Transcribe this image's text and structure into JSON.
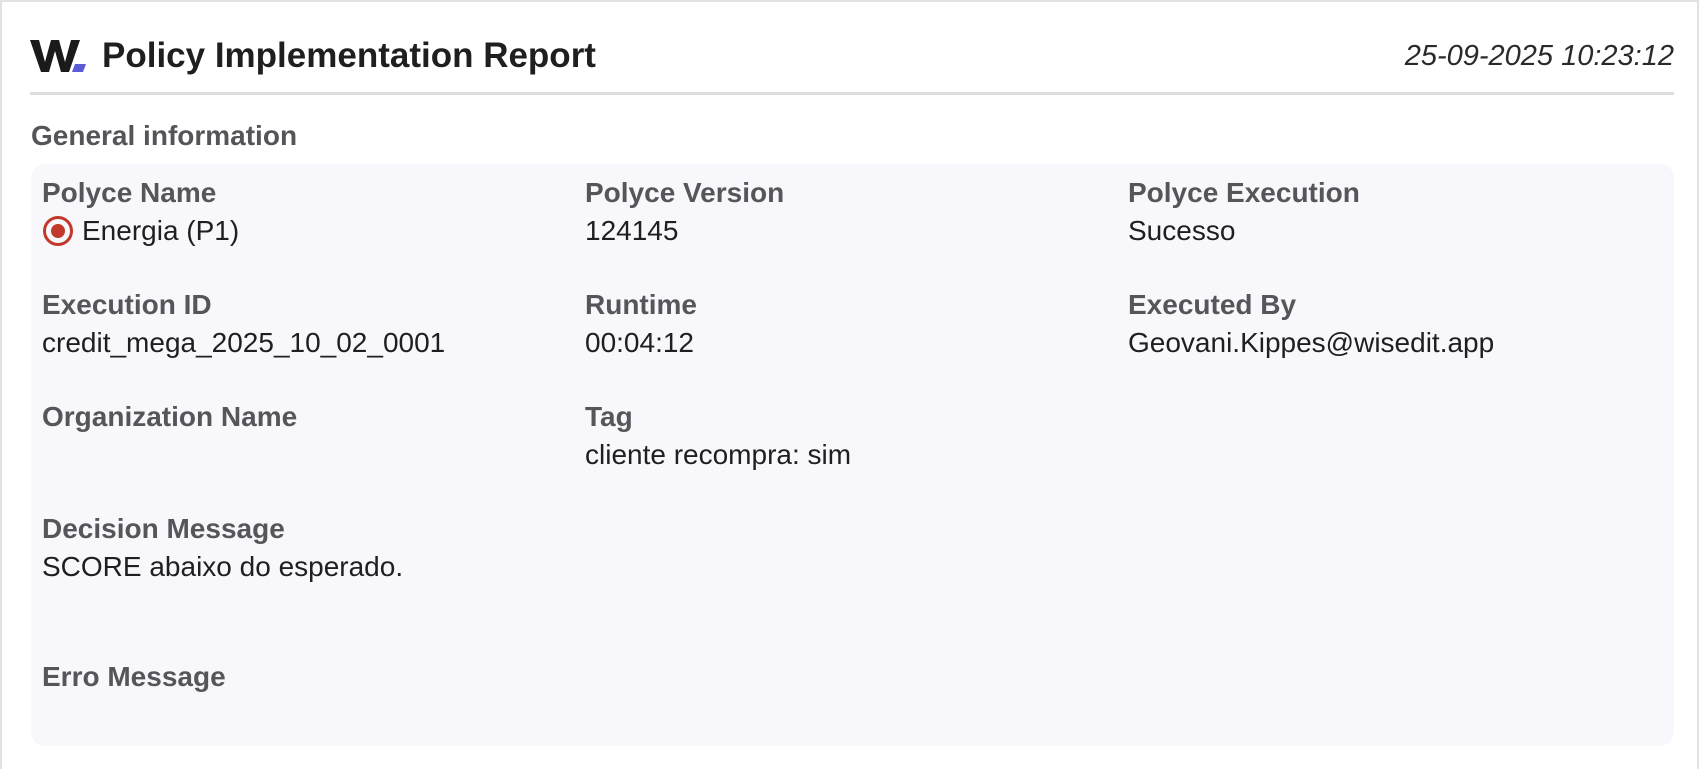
{
  "header": {
    "logo_icon": "w-brand-logo-icon",
    "title": "Policy Implementation Report",
    "timestamp": "25-09-2025 10:23:12"
  },
  "section": {
    "title": "General information"
  },
  "fields": {
    "policy_name": {
      "label": "Polyce Name",
      "value": "Energia (P1)",
      "icon": "record-status-icon",
      "icon_color": "#c0392b"
    },
    "policy_version": {
      "label": "Polyce Version",
      "value": "124145"
    },
    "policy_execution": {
      "label": "Polyce Execution",
      "value": "Sucesso"
    },
    "execution_id": {
      "label": "Execution ID",
      "value": "credit_mega_2025_10_02_0001"
    },
    "runtime": {
      "label": "Runtime",
      "value": "00:04:12"
    },
    "executed_by": {
      "label": "Executed By",
      "value": "Geovani.Kippes@wisedit.app"
    },
    "organization_name": {
      "label": "Organization Name",
      "value": ""
    },
    "tag": {
      "label": "Tag",
      "value": "cliente recompra: sim"
    },
    "decision_message": {
      "label": "Decision Message",
      "value": "SCORE abaixo do esperado."
    },
    "error_message": {
      "label": "Erro Message",
      "value": ""
    }
  },
  "colors": {
    "brand_dark": "#1a1a1a",
    "brand_accent": "#5b5bd6",
    "panel_bg": "#f7f7fc",
    "label_text": "#55555a",
    "status_red": "#c0392b"
  }
}
